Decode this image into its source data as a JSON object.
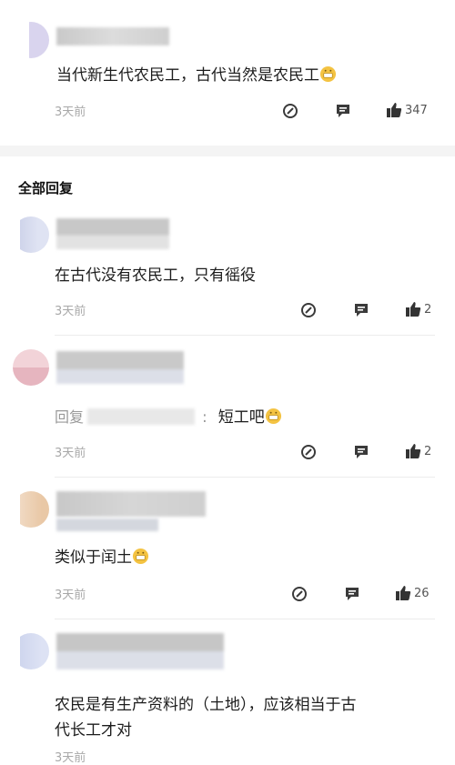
{
  "top_comment": {
    "text": "当代新生代农民工，古代当然是农民工",
    "time": "3天前",
    "likes": "347"
  },
  "section_title": "全部回复",
  "replies": [
    {
      "text": "在古代没有农民工，只有徭役",
      "time": "3天前",
      "likes": "2"
    },
    {
      "prefix": "回复",
      "sep": ":",
      "text": "短工吧",
      "time": "3天前",
      "likes": "2"
    },
    {
      "text": "类似于闰土",
      "time": "3天前",
      "likes": "26"
    },
    {
      "text_line1": "农民是有生产资料的（土地），应该相当于古",
      "text_line2": "代长工才对",
      "time": "3天前"
    }
  ],
  "colors": {
    "like": "#333333",
    "icon": "#3a3a3a",
    "emoji": "#f4c342"
  }
}
